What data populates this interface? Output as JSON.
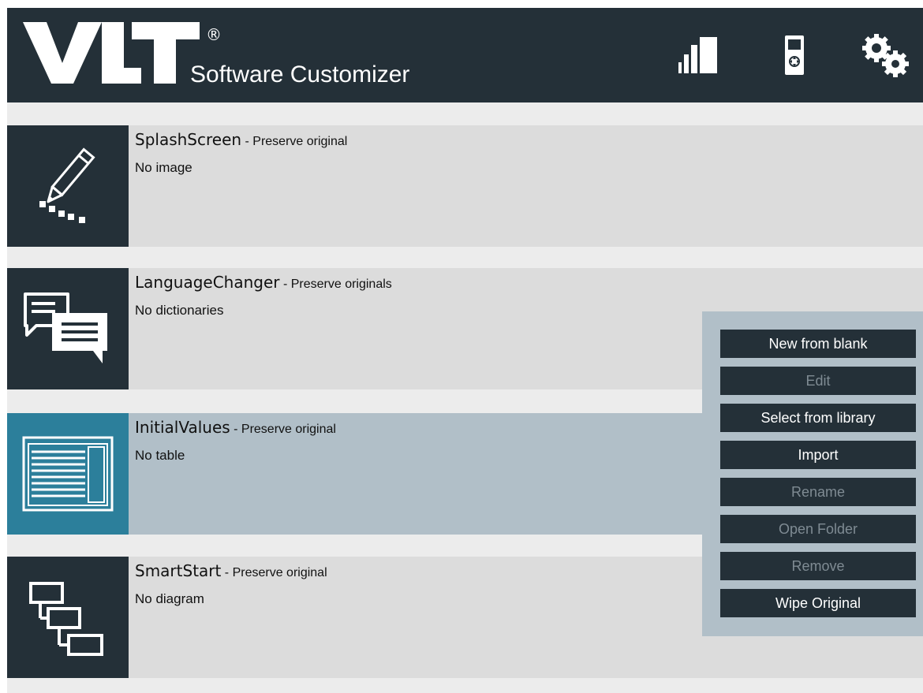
{
  "header": {
    "logo_text": "VLT",
    "logo_mark": "®",
    "subtitle": "Software Customizer",
    "buttons": [
      {
        "icon": "signal-bars-icon"
      },
      {
        "icon": "control-panel-icon"
      },
      {
        "icon": "gears-icon"
      }
    ]
  },
  "modules": [
    {
      "name": "SplashScreen",
      "status": " - Preserve original",
      "detail": "No image",
      "icon": "pencil-icon",
      "selected": false
    },
    {
      "name": "LanguageChanger",
      "status": " - Preserve originals",
      "detail": "No dictionaries",
      "icon": "speech-bubbles-icon",
      "selected": false
    },
    {
      "name": "InitialValues",
      "status": " - Preserve original",
      "detail": "No table",
      "icon": "table-window-icon",
      "selected": true
    },
    {
      "name": "SmartStart",
      "status": " - Preserve original",
      "detail": "No diagram",
      "icon": "stepped-boxes-icon",
      "selected": false
    }
  ],
  "context_menu": {
    "items": [
      {
        "label": "New from blank",
        "enabled": true
      },
      {
        "label": "Edit",
        "enabled": false
      },
      {
        "label": "Select from library",
        "enabled": true
      },
      {
        "label": "Import",
        "enabled": true
      },
      {
        "label": "Rename",
        "enabled": false
      },
      {
        "label": "Open Folder",
        "enabled": false
      },
      {
        "label": "Remove",
        "enabled": false
      },
      {
        "label": "Wipe Original",
        "enabled": true
      }
    ]
  },
  "colors": {
    "header_bg": "#243038",
    "row_bg": "#dcdcdc",
    "selected_bg": "#b1bfc8",
    "selected_icon_bg": "#2c7f9b",
    "button_bg": "#243038",
    "disabled_text": "#7f8b93"
  }
}
